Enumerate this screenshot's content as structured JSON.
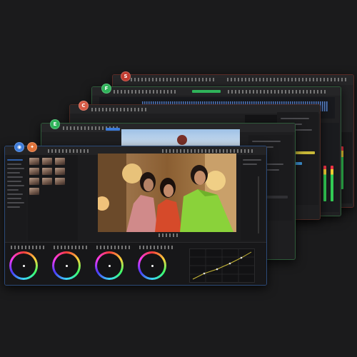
{
  "apps": [
    {
      "id": "fairlight",
      "logo_color": "#d9463a",
      "accent": "#c1443b"
    },
    {
      "id": "fusion",
      "logo_color": "#2fb35a",
      "accent": "#2fa85a"
    },
    {
      "id": "cut",
      "logo_color": "#d65a45",
      "accent": "#d65a45"
    },
    {
      "id": "edit",
      "logo_color": "#2fb35a",
      "accent": "#37b466"
    },
    {
      "id": "color",
      "logo_color": "#3d7bd9",
      "accent": "#3d7bd9",
      "secondary_logo_color": "#e0733a"
    }
  ],
  "color_wheels": [
    "lift",
    "gamma",
    "gain",
    "offset"
  ],
  "colors": {
    "background": "#1b1b1c",
    "panel": "#1e1e20",
    "curve": "#c8b838"
  }
}
